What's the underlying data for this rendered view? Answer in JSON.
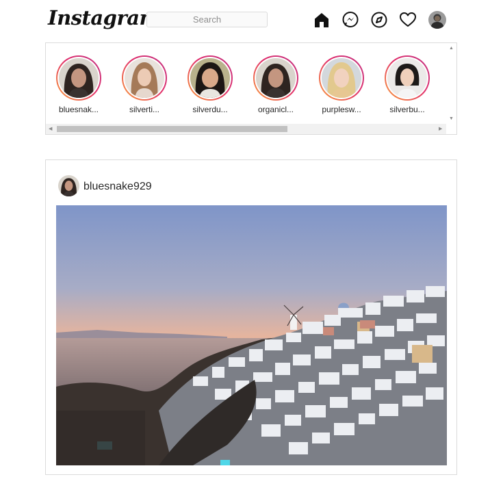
{
  "header": {
    "logo_text": "Instagram",
    "search": {
      "placeholder": "Search",
      "value": ""
    },
    "nav_icons": [
      "home-icon",
      "messenger-icon",
      "explore-icon",
      "heart-icon",
      "profile-avatar"
    ]
  },
  "stories": {
    "items": [
      {
        "username": "bluesnak..."
      },
      {
        "username": "silverti..."
      },
      {
        "username": "silverdu..."
      },
      {
        "username": "organicl..."
      },
      {
        "username": "purplesw..."
      },
      {
        "username": "silverbu..."
      }
    ]
  },
  "post": {
    "username": "bluesnake929",
    "photo_description_icon": "santorini-photo"
  },
  "colors": {
    "border": "#dbdbdb",
    "story_ring_start": "#f9a03a",
    "story_ring_end": "#c13584",
    "text": "#262626"
  }
}
